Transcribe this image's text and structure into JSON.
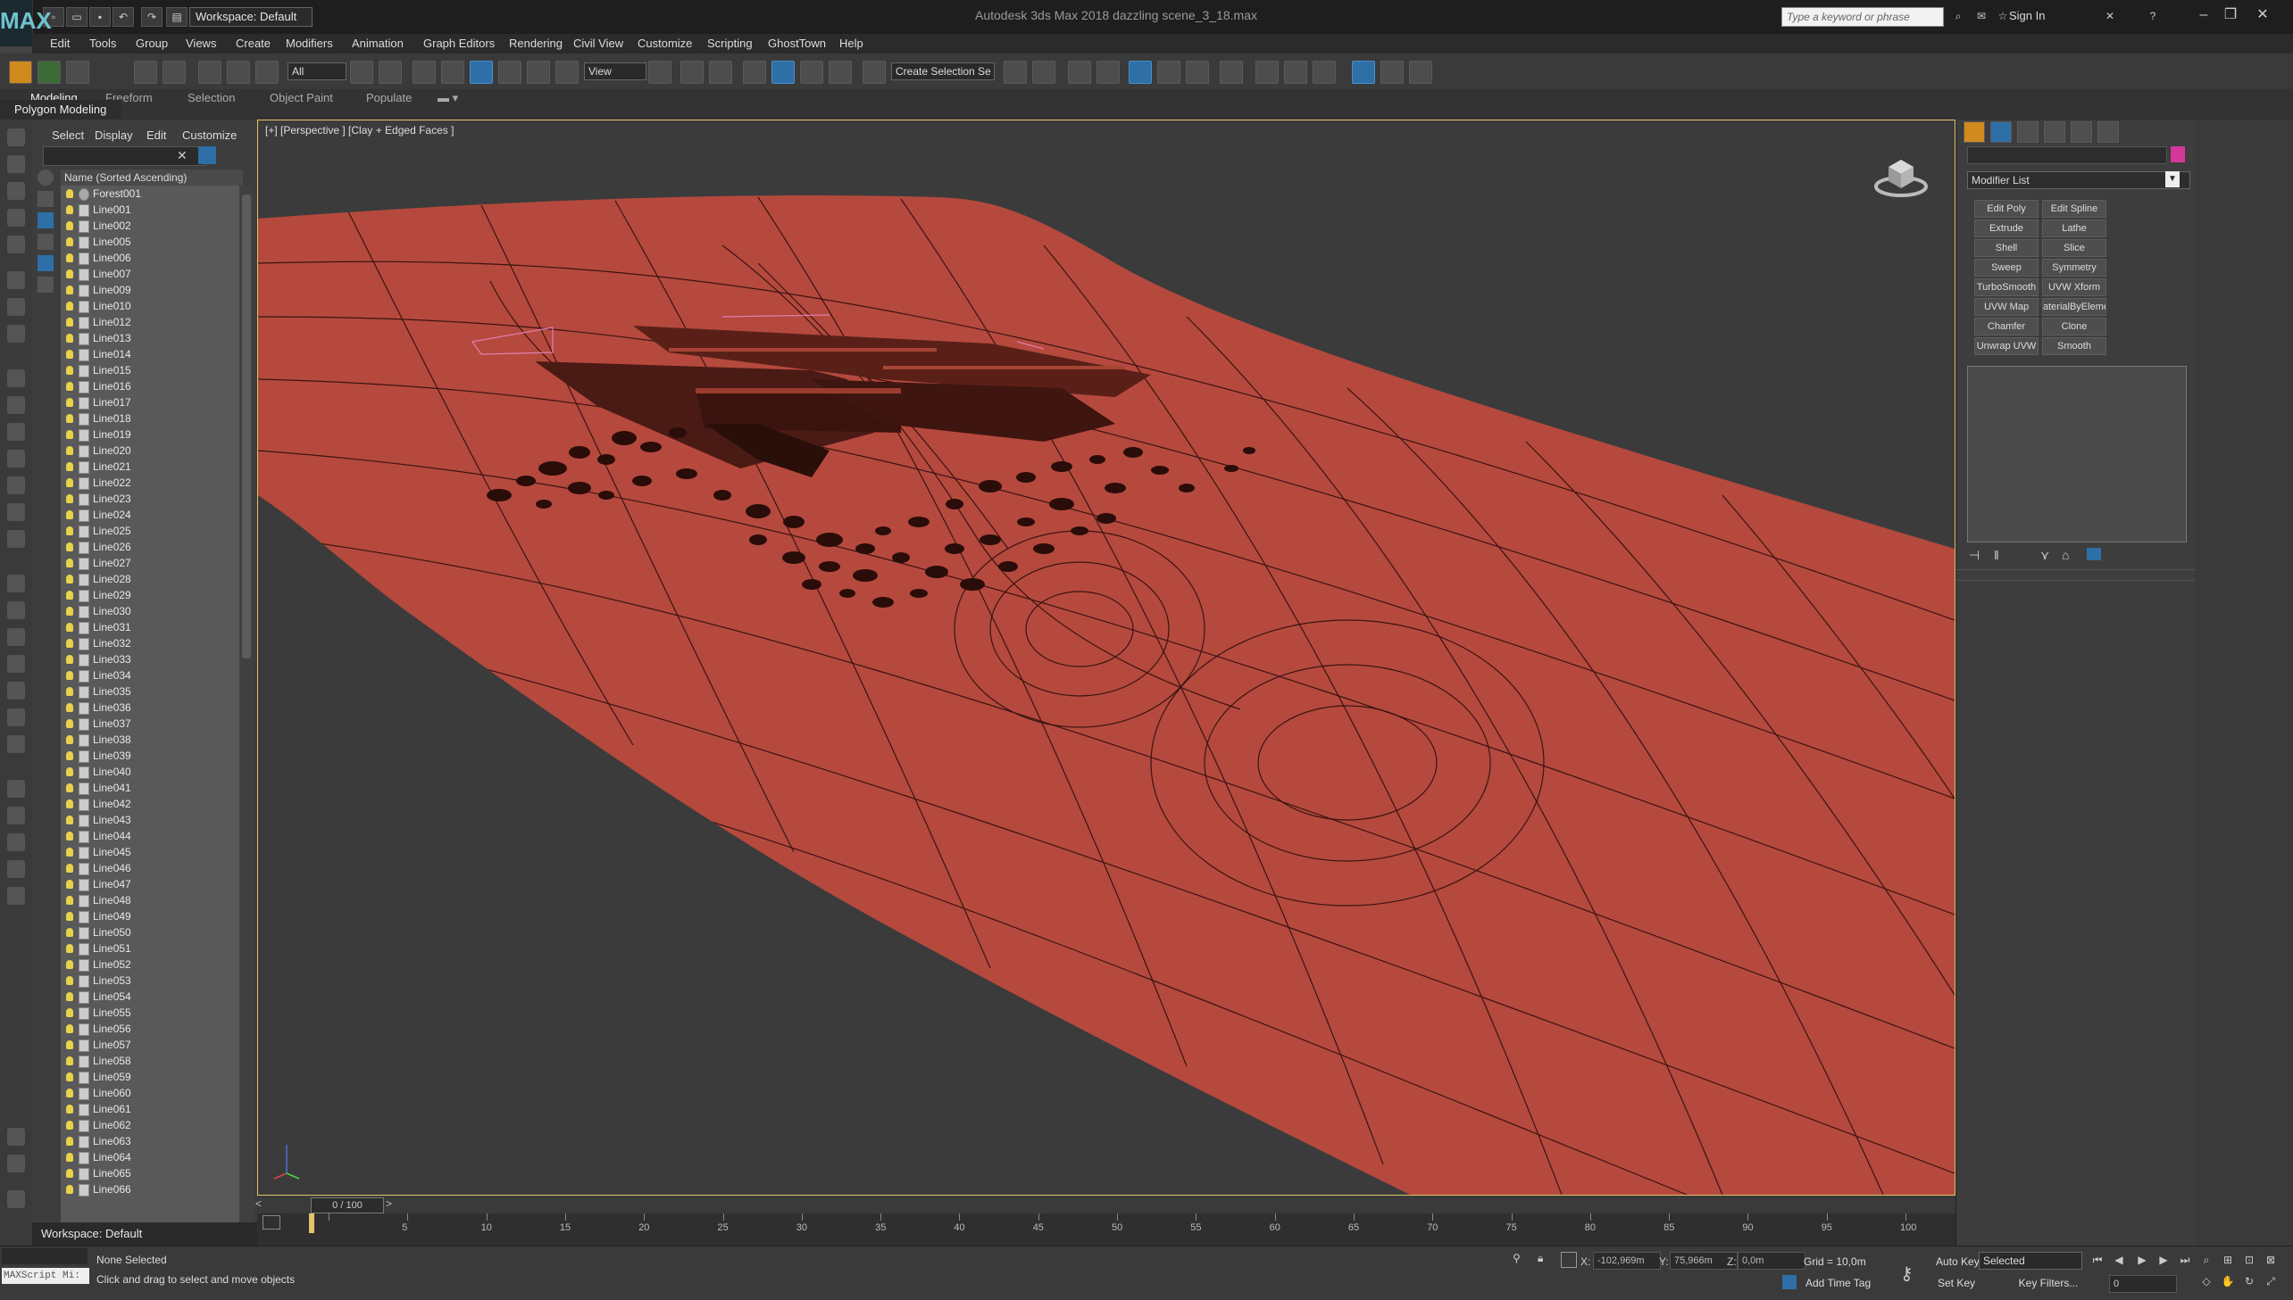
{
  "window": {
    "title": "Autodesk 3ds Max 2018   dazzling scene_3_18.max",
    "workspace": "Workspace: Default",
    "search_placeholder": "Type a keyword or phrase",
    "sign_in": "Sign In",
    "app_logo": "MAX"
  },
  "menu": [
    "Edit",
    "Tools",
    "Group",
    "Views",
    "Create",
    "Modifiers",
    "Animation",
    "Graph Editors",
    "Rendering",
    "Civil View",
    "Customize",
    "Scripting",
    "GhostTown",
    "Help"
  ],
  "toolbar": {
    "selection_filter": "All",
    "ref_coord": "View",
    "named_selection": "Create Selection Se"
  },
  "ribbon": {
    "tabs": [
      "Modeling",
      "Freeform",
      "Selection",
      "Object Paint",
      "Populate"
    ],
    "panel": "Polygon Modeling"
  },
  "explorer": {
    "menu": [
      "Select",
      "Display",
      "Edit",
      "Customize"
    ],
    "column_header": "Name (Sorted Ascending)",
    "items": [
      "Forest001",
      "Line001",
      "Line002",
      "Line005",
      "Line006",
      "Line007",
      "Line009",
      "Line010",
      "Line012",
      "Line013",
      "Line014",
      "Line015",
      "Line016",
      "Line017",
      "Line018",
      "Line019",
      "Line020",
      "Line021",
      "Line022",
      "Line023",
      "Line024",
      "Line025",
      "Line026",
      "Line027",
      "Line028",
      "Line029",
      "Line030",
      "Line031",
      "Line032",
      "Line033",
      "Line034",
      "Line035",
      "Line036",
      "Line037",
      "Line038",
      "Line039",
      "Line040",
      "Line041",
      "Line042",
      "Line043",
      "Line044",
      "Line045",
      "Line046",
      "Line047",
      "Line048",
      "Line049",
      "Line050",
      "Line051",
      "Line052",
      "Line053",
      "Line054",
      "Line055",
      "Line056",
      "Line057",
      "Line058",
      "Line059",
      "Line060",
      "Line061",
      "Line062",
      "Line063",
      "Line064",
      "Line065",
      "Line066"
    ],
    "footer": "Workspace: Default"
  },
  "viewport": {
    "label": "[+] [Perspective ] [Clay + Edged Faces ]",
    "terrain_color": "#b5493e",
    "background_color": "#3b3b3b"
  },
  "command_panel": {
    "modifier_list": "Modifier List",
    "modifier_buttons": [
      "Edit Poly",
      "Edit Spline",
      "Extrude",
      "Lathe",
      "Shell",
      "Slice",
      "Sweep",
      "Symmetry",
      "TurboSmooth",
      "UVW Xform",
      "UVW Map",
      "aterialByEleme",
      "Chamfer",
      "Clone",
      "Unwrap UVW",
      "Smooth"
    ],
    "object_color": "#d4379a"
  },
  "timeline": {
    "position": "0 / 100",
    "ticks": [
      "0",
      "5",
      "10",
      "15",
      "20",
      "25",
      "30",
      "35",
      "40",
      "45",
      "50",
      "55",
      "60",
      "65",
      "70",
      "75",
      "80",
      "85",
      "90",
      "95",
      "100"
    ]
  },
  "status": {
    "maxscript": "MAXScript Mi:",
    "selection": "None Selected",
    "prompt": "Click and drag to select and move objects",
    "x_label": "X:",
    "x_value": "-102,969m",
    "y_label": "Y:",
    "y_value": "75,966m",
    "z_label": "Z:",
    "z_value": "0,0m",
    "grid": "Grid = 10,0m",
    "add_time_tag": "Add Time Tag",
    "auto_key": "Auto Key",
    "set_key": "Set Key",
    "selected_dropdown": "Selected",
    "key_filters": "Key Filters...",
    "current_frame": "0"
  }
}
